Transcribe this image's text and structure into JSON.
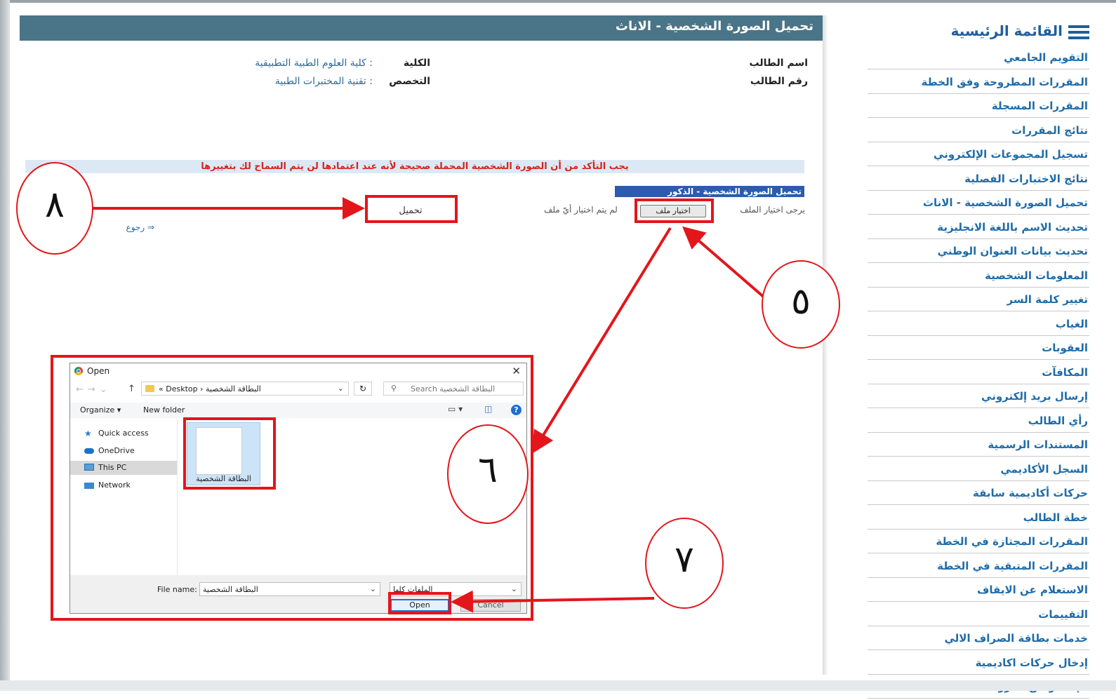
{
  "header": {
    "title": "تحميل الصورة الشخصية - الاناث"
  },
  "student_info": {
    "name_label": "اسم الطالب",
    "id_label": "رقم الطالب",
    "college_label": "الكلية",
    "college_value": ": كلية العلوم الطبية التطبيقية",
    "major_label": "التخصص",
    "major_value": ": تقنية المختبرات الطبية"
  },
  "notice": "يجب التأكد من أن الصورة الشخصية المحملة صحيحة لأنه عند اعتمادها لن يتم السماح لك بتغييرها",
  "upload_section": {
    "title": "تحميل الصورة الشخصية - الذكور",
    "file_label": "يرجى اختيار الملف",
    "choose_button": "اختيار ملف",
    "no_file": "لم يتم اختيار أيّ ملف",
    "upload_button": "تحميل",
    "back_link": "رجوع"
  },
  "sidebar": {
    "title": "القائمة الرئيسية",
    "items": [
      "التقويم الجامعي",
      "المقررات المطروحة وفق الخطة",
      "المقررات المسجلة",
      "نتائج المقررات",
      "تسجيل المجموعات الإلكتروني",
      "نتائج الاختبارات الفصلية",
      "تحميل الصورة الشخصية - الاناث",
      "تحديث الاسم باللغة الانجليزية",
      "تحديث بيانات العنوان الوطني",
      "المعلومات الشخصية",
      "تغيير كلمة السر",
      "الغياب",
      "العقوبات",
      "المكافآت",
      "إرسال بريد إلكتروني",
      "رأي الطالب",
      "المستندات الرسمية",
      "السجل الأكاديمي",
      "حركات أكاديمية سابقة",
      "خطة الطالب",
      "المقررات المجتازة في الخطة",
      "المقررات المتبقية في الخطة",
      "الاستعلام عن الايقاف",
      "التقييمات",
      "خدمات بطاقة الصراف الالي",
      "إدخال حركات اكاديمية",
      "الإعتذار عن مقرر"
    ]
  },
  "dialog": {
    "title": "Open",
    "address": "« Desktop › البطاقة الشخصية",
    "search_placeholder": "Search البطاقة الشخصية",
    "organize": "Organize ▾",
    "new_folder": "New folder",
    "nav_items": [
      {
        "label": "Quick access",
        "icon": "star-icon"
      },
      {
        "label": "OneDrive",
        "icon": "cloud-icon"
      },
      {
        "label": "This PC",
        "icon": "computer-icon",
        "selected": true
      },
      {
        "label": "Network",
        "icon": "network-icon"
      }
    ],
    "file_item": "البطاقة الشخصية",
    "file_name_label": "File name:",
    "file_name_value": "البطاقة الشخصية",
    "file_type": "الملفات كلها",
    "open_button": "Open",
    "cancel_button": "Cancel"
  },
  "annotations": {
    "color": "#e3161b",
    "step5": "٥",
    "step6": "٦",
    "step7": "٧",
    "step8": "٨"
  }
}
